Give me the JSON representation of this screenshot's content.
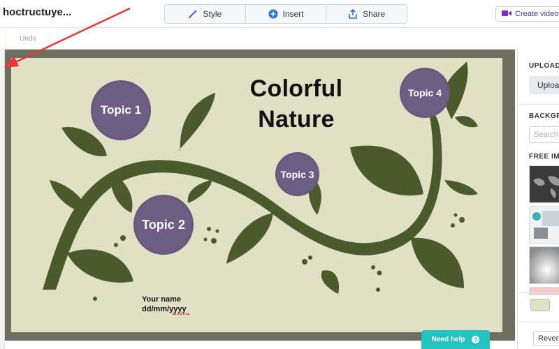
{
  "app": {
    "doc_title": "hoctructuye...",
    "toolbar": {
      "style": "Style",
      "insert": "Insert",
      "share": "Share",
      "create_video": "Create video"
    },
    "undo": "Undo"
  },
  "slide": {
    "title_line1": "Colorful",
    "title_line2": "Nature",
    "topics": [
      "Topic 1",
      "Topic 2",
      "Topic 3",
      "Topic 4"
    ],
    "your_name": "Your name",
    "date": "dd/mm/yyyy",
    "background_color": "#dfe0c4",
    "topic_color": "#6d5f84",
    "leaf_color": "#4a5a2a"
  },
  "right_panel": {
    "upload_heading": "UPLOAD",
    "upload_button": "Uploa",
    "background_heading": "BACKGR",
    "search_placeholder": "Search",
    "free_images_heading": "FREE IMA",
    "revert_button": "Revert"
  },
  "need_help": "Need help",
  "help_icon": "?",
  "accent_color": "#22c3c0",
  "annotation_color": "#e53935"
}
